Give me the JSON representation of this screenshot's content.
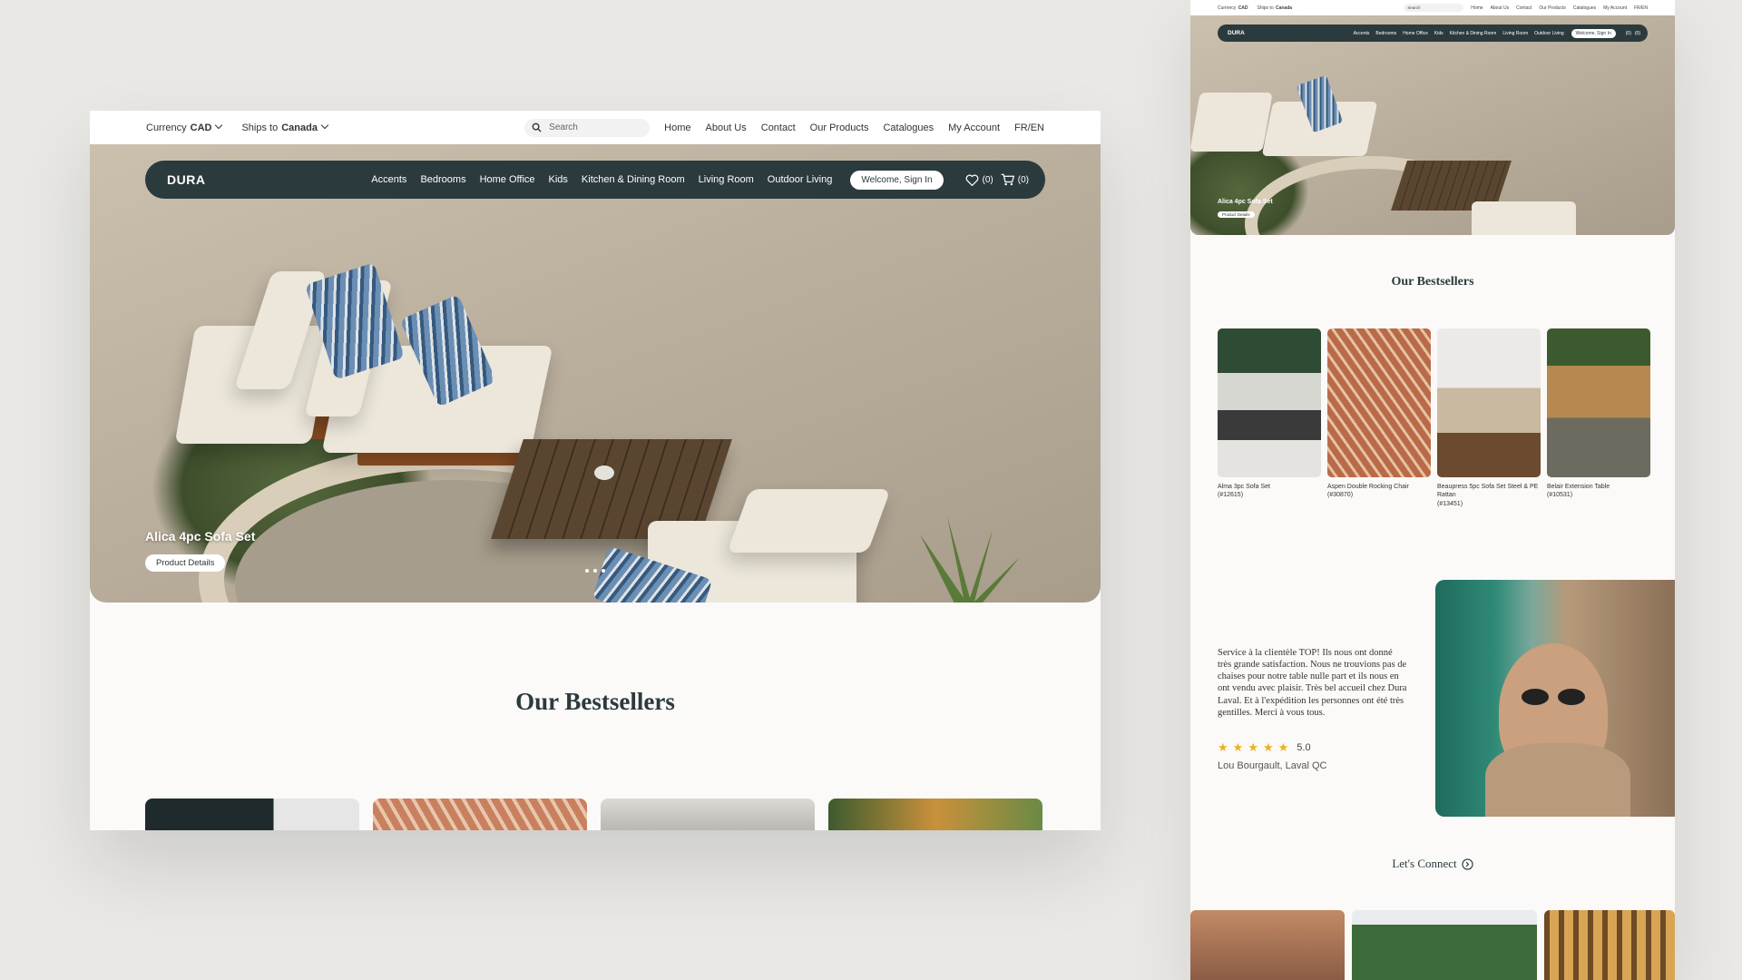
{
  "left": {
    "topbar": {
      "currency_label": "Currency",
      "currency_value": "CAD",
      "ships_label": "Ships to",
      "ships_value": "Canada",
      "search_placeholder": "Search",
      "links": [
        "Home",
        "About Us",
        "Contact",
        "Our Products",
        "Catalogues",
        "My Account",
        "FR/EN"
      ]
    },
    "nav": {
      "logo": "DURA",
      "categories": [
        "Accents",
        "Bedrooms",
        "Home Office",
        "Kids",
        "Kitchen & Dining Room",
        "Living Room",
        "Outdoor Living"
      ],
      "signin": "Welcome, Sign In",
      "wishlist_count": "(0)",
      "cart_count": "(0)"
    },
    "hero": {
      "caption": "Alica 4pc Sofa Set",
      "button": "Product Details",
      "slides": 3
    },
    "bestsellers_title": "Our Bestsellers"
  },
  "right": {
    "topbar": {
      "currency_label": "Currency",
      "currency_value": "CAD",
      "ships_label": "Ships to",
      "ships_value": "Canada",
      "search_placeholder": "Search",
      "links": [
        "Home",
        "About Us",
        "Contact",
        "Our Products",
        "Catalogues",
        "My Account",
        "FR/EN"
      ]
    },
    "nav": {
      "logo": "DURA",
      "categories": [
        "Accents",
        "Bedrooms",
        "Home Office",
        "Kids",
        "Kitchen & Dining Room",
        "Living Room",
        "Outdoor Living"
      ],
      "signin": "Welcome, Sign In",
      "wishlist_count": "(0)",
      "cart_count": "(0)"
    },
    "hero": {
      "caption": "Alica 4pc Sofa Set",
      "button": "Product Details"
    },
    "bestsellers_title": "Our Bestsellers",
    "products": [
      {
        "name": "Alma 3pc Sofa Set",
        "code": "(#12615)"
      },
      {
        "name": "Aspen Double Rocking Chair",
        "code": "(#30870)"
      },
      {
        "name": "Beaupress 5pc Sofa Set Steel & PE Rattan",
        "code": "(#13451)"
      },
      {
        "name": "Belair Extension Table",
        "code": "(#10531)"
      }
    ],
    "testimonial": {
      "quote": "Service à la clientèle TOP! Ils nous ont donné très grande satisfaction. Nous ne trouvions pas de chaises pour notre table nulle part et ils nous en ont vendu avec plaisir. Très bel accueil chez Dura Laval. Et à l'expédition les personnes ont été très gentilles. Merci à vous tous.",
      "stars": 5,
      "rating": "5.0",
      "author": "Lou Bourgault, Laval QC"
    },
    "connect_title": "Let's Connect"
  },
  "colors": {
    "nav_bg": "#2b3a3d",
    "page_bg": "#e9e8e5",
    "card_bg": "#fbfaf8",
    "star": "#e8b323"
  }
}
